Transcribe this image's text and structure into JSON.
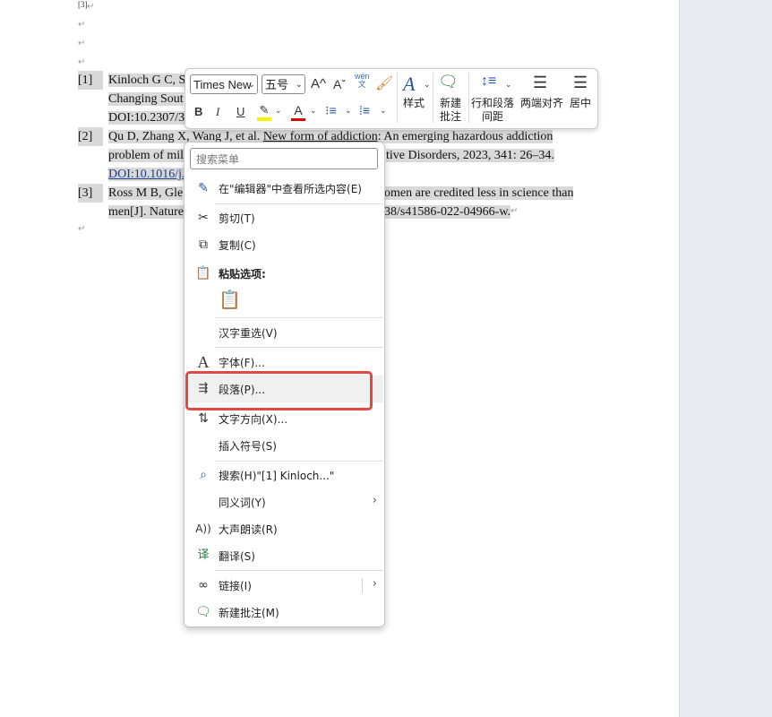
{
  "doc": {
    "sup_label": "[3]",
    "para_mark": "↵",
    "refs": [
      {
        "num": "[1]",
        "line1": "Kinloch G C, S",
        "line2": "Changing Sout",
        "line3": "DOI:10.2307/3"
      },
      {
        "num": "[2]",
        "line1_a": "Qu D, Zhang X, Wang J, et al. ",
        "line1_b": "New form of addiction",
        "line1_c": ": An emerging hazardous addiction",
        "line2_a": "problem of mil",
        "line2_b": "tive Disorders, 2023, 341: 26–34.",
        "line3": "DOI:10.1016/j."
      },
      {
        "num": "[3]",
        "line1_a": "Ross M B, Gle",
        "line1_b": "omen are credited less in science than",
        "line2_a": "men[J]. Nature",
        "line2_b": "38/s41586-022-04966-w."
      }
    ]
  },
  "toolbar": {
    "font_name": "Times New",
    "font_size": "五号",
    "grow_font": "A^",
    "shrink_font": "Aˇ",
    "bold": "B",
    "italic": "I",
    "underline": "U",
    "styles_label": "样式",
    "new_comment_label1": "新建",
    "new_comment_label2": "批注",
    "line_spacing_label1": "行和段落",
    "line_spacing_label2": "间距",
    "justify_label": "两端对齐",
    "center_label": "居中"
  },
  "menu": {
    "search_placeholder": "搜索菜单",
    "items": [
      {
        "label": "在\"编辑器\"中查看所选内容(E)",
        "icon": "editor-pen-icon"
      },
      {
        "label": "剪切(T)",
        "icon": "scissors-icon"
      },
      {
        "label": "复制(C)",
        "icon": "copy-icon"
      },
      {
        "label": "粘贴选项:",
        "icon": "paste-icon"
      },
      {
        "label": "汉字重选(V)",
        "icon": ""
      },
      {
        "label": "字体(F)...",
        "icon": "font-icon"
      },
      {
        "label": "段落(P)...",
        "icon": "paragraph-icon"
      },
      {
        "label": "文字方向(X)...",
        "icon": "text-direction-icon"
      },
      {
        "label": "插入符号(S)",
        "icon": ""
      },
      {
        "label": "搜索(H)\"[1]     Kinloch...\"",
        "icon": "search-icon"
      },
      {
        "label": "同义词(Y)",
        "icon": ""
      },
      {
        "label": "大声朗读(R)",
        "icon": "read-aloud-icon"
      },
      {
        "label": "翻译(S)",
        "icon": "translate-icon"
      },
      {
        "label": "链接(I)",
        "icon": "link-icon"
      },
      {
        "label": "新建批注(M)",
        "icon": "new-comment-icon"
      }
    ]
  },
  "colors": {
    "highlight_box": "#e34a3f",
    "selection": "#d9d9d9",
    "highlighter": "#f5f500",
    "font_color": "#e00000"
  }
}
